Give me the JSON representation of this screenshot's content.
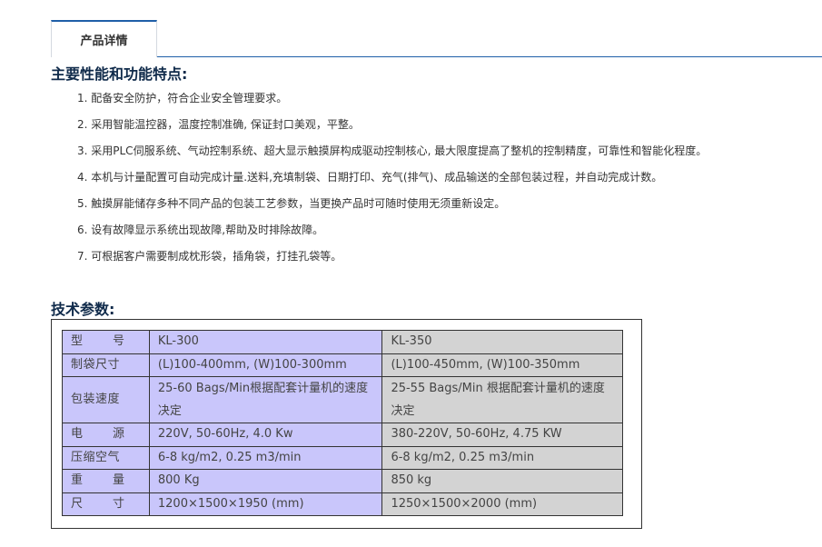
{
  "tabs": [
    {
      "label": "产品详情"
    }
  ],
  "features_title": "主要性能和功能特点:",
  "features": [
    "1. 配备安全防护，符合企业安全管理要求。",
    "2. 采用智能温控器，温度控制准确, 保证封口美观，平整。",
    "3. 采用PLC伺服系统、气动控制系统、超大显示触摸屏构成驱动控制核心, 最大限度提高了整机的控制精度，可靠性和智能化程度。",
    "4. 本机与计量配置可自动完成计量.送料,充填制袋、日期打印、充气(排气)、成品输送的全部包装过程，并自动完成计数。",
    "5. 触摸屏能储存多种不同产品的包装工艺参数，当更换产品时可随时使用无须重新设定。",
    "6. 设有故障显示系统出现故障,帮助及时排除故障。",
    "7. 可根据客户需要制成枕形袋，插角袋，打挂孔袋等。"
  ],
  "spec_title": "技术参数:",
  "spec_rows": [
    {
      "label": "型　号",
      "kl300": "KL-300",
      "kl350": "KL-350"
    },
    {
      "label": "制袋尺寸",
      "kl300": "(L)100-400mm, (W)100-300mm",
      "kl350": "(L)100-450mm, (W)100-350mm"
    },
    {
      "label": "包装速度",
      "kl300": "25-60 Bags/Min根据配套计量机的速度决定",
      "kl350": "25-55 Bags/Min 根据配套计量机的速度决定"
    },
    {
      "label": "电　源",
      "kl300": "220V, 50-60Hz, 4.0 Kw",
      "kl350": "380-220V, 50-60Hz, 4.75 KW"
    },
    {
      "label": "压缩空气",
      "kl300": "6-8 kg/m2, 0.25 m3/min",
      "kl350": "6-8 kg/m2, 0.25 m3/min"
    },
    {
      "label": "重　量",
      "kl300": "800 Kg",
      "kl350": "850 kg"
    },
    {
      "label": "尺　寸",
      "kl300": "1200×1500×1950 (mm)",
      "kl350": "1250×1500×2000 (mm)"
    }
  ],
  "colors": {
    "accent": "#1f5fa8",
    "title": "#0f2a4a",
    "col1_bg": "#c9c6fb",
    "col2_bg": "#d3d3d3"
  }
}
